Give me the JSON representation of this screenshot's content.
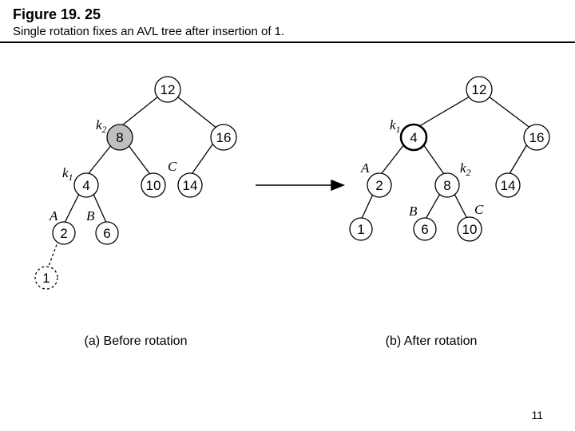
{
  "figure_number": "Figure 19. 25",
  "figure_caption": "Single rotation fixes an AVL tree after insertion of 1.",
  "page_number": "11",
  "trees": {
    "before": {
      "caption": "(a) Before rotation",
      "nodes": {
        "n12": {
          "value": "12",
          "highlight": false,
          "dashed": false
        },
        "n8": {
          "value": "8",
          "highlight": true,
          "dashed": false,
          "k": "k",
          "ksub": "2"
        },
        "n16": {
          "value": "16",
          "highlight": false,
          "dashed": false
        },
        "n4": {
          "value": "4",
          "highlight": false,
          "dashed": false,
          "k": "k",
          "ksub": "1"
        },
        "n10": {
          "value": "10",
          "highlight": false,
          "dashed": false,
          "ann": "C"
        },
        "n14": {
          "value": "14",
          "highlight": false,
          "dashed": false
        },
        "n2": {
          "value": "2",
          "highlight": false,
          "dashed": false,
          "ann": "A"
        },
        "n6": {
          "value": "6",
          "highlight": false,
          "dashed": false,
          "ann": "B"
        },
        "n1": {
          "value": "1",
          "highlight": false,
          "dashed": true
        }
      }
    },
    "after": {
      "caption": "(b) After rotation",
      "nodes": {
        "n12": {
          "value": "12",
          "highlight": false,
          "dashed": false
        },
        "n4": {
          "value": "4",
          "highlight": false,
          "dashed": false,
          "bold": true,
          "k": "k",
          "ksub": "1"
        },
        "n16": {
          "value": "16",
          "highlight": false,
          "dashed": false
        },
        "n2": {
          "value": "2",
          "highlight": false,
          "dashed": false,
          "ann": "A"
        },
        "n8": {
          "value": "8",
          "highlight": false,
          "dashed": false,
          "k": "k",
          "ksub": "2"
        },
        "n14": {
          "value": "14",
          "highlight": false,
          "dashed": false
        },
        "n1": {
          "value": "1",
          "highlight": false,
          "dashed": false
        },
        "n6": {
          "value": "6",
          "highlight": false,
          "dashed": false,
          "ann": "B"
        },
        "n10": {
          "value": "10",
          "highlight": false,
          "dashed": false,
          "ann": "C"
        }
      }
    }
  }
}
